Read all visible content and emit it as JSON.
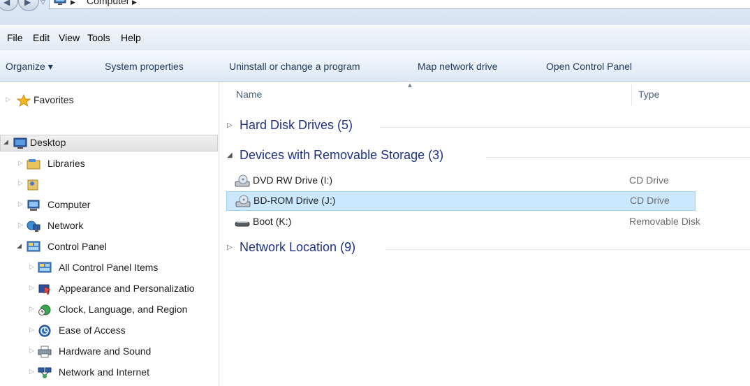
{
  "address": {
    "path_segment": "Computer",
    "separator": "▶"
  },
  "menu": {
    "items": [
      "File",
      "Edit",
      "View",
      "Tools",
      "Help"
    ]
  },
  "commands": {
    "organize": "Organize ▾",
    "system_properties": "System properties",
    "uninstall": "Uninstall or change a program",
    "map_drive": "Map network drive",
    "control_panel": "Open Control Panel"
  },
  "nav": {
    "favorites": "Favorites",
    "desktop": "Desktop",
    "libraries": "Libraries",
    "user_folder": "",
    "computer": "Computer",
    "network": "Network",
    "control_panel": "Control Panel",
    "cp_items": [
      "All Control Panel Items",
      "Appearance and Personalizatio",
      "Clock, Language, and Region",
      "Ease of Access",
      "Hardware and Sound",
      "Network and Internet"
    ]
  },
  "columns": {
    "name": "Name",
    "type": "Type"
  },
  "groups": {
    "hard_disks": "Hard Disk Drives (5)",
    "removable": "Devices with Removable Storage (3)",
    "network": "Network Location (9)"
  },
  "items": [
    {
      "name": "DVD RW Drive (I:)",
      "type": "CD Drive",
      "icon": "optical-drive-icon"
    },
    {
      "name": "BD-ROM Drive (J:)",
      "type": "CD Drive",
      "icon": "optical-drive-icon"
    },
    {
      "name": "Boot (K:)",
      "type": "Removable Disk",
      "icon": "removable-disk-icon"
    }
  ],
  "colors": {
    "group_heading": "#1e3287",
    "selection_bg": "#cce8ff",
    "selection_border": "#99d1ff"
  }
}
